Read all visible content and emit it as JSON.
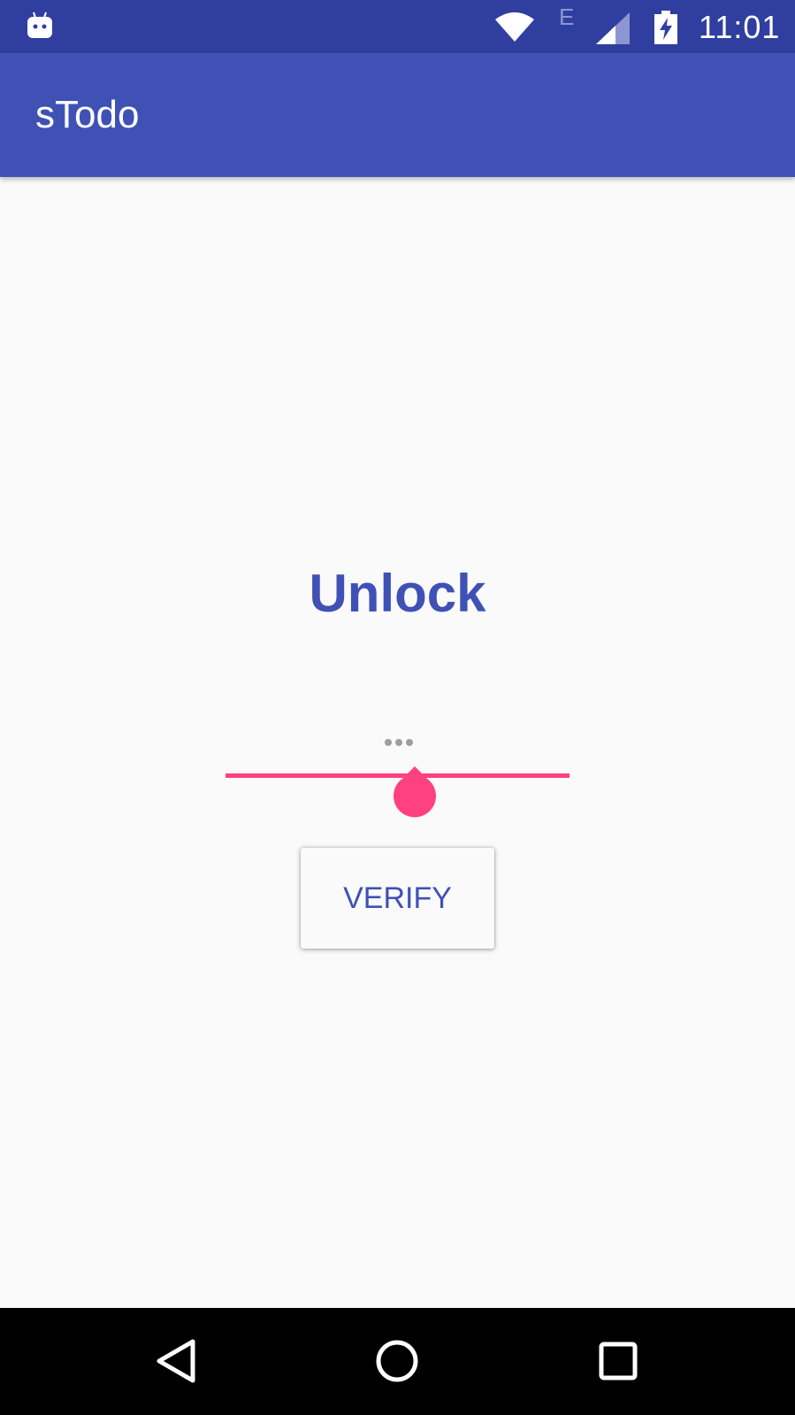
{
  "status_bar": {
    "network_type": "E",
    "time": "11:01",
    "icons": [
      "android-icon",
      "wifi-icon",
      "cell-signal-icon",
      "battery-charging-icon"
    ]
  },
  "app_bar": {
    "title": "sTodo"
  },
  "unlock": {
    "title": "Unlock",
    "slider_level": 0.55,
    "verify_label": "VERIFY"
  },
  "nav_bar": {
    "icons": [
      "back-icon",
      "home-icon",
      "recents-icon"
    ]
  },
  "colors": {
    "status_bar": "#303f9f",
    "primary": "#3f51b5",
    "accent": "#ff4081",
    "background": "#fafafa"
  }
}
